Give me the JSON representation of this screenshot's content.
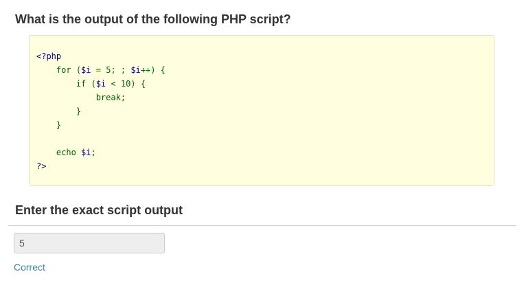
{
  "question": {
    "title": "What is the output of the following PHP script?"
  },
  "code": {
    "lines": [
      [
        {
          "t": "<?php",
          "c": "tag"
        }
      ],
      [
        {
          "t": "    ",
          "c": ""
        },
        {
          "t": "for",
          "c": "kw"
        },
        {
          "t": " (",
          "c": "punc"
        },
        {
          "t": "$i",
          "c": "var"
        },
        {
          "t": " = ",
          "c": "punc"
        },
        {
          "t": "5",
          "c": "num"
        },
        {
          "t": "; ; ",
          "c": "punc"
        },
        {
          "t": "$i",
          "c": "var"
        },
        {
          "t": "++) {",
          "c": "punc"
        }
      ],
      [
        {
          "t": "        ",
          "c": ""
        },
        {
          "t": "if",
          "c": "kw"
        },
        {
          "t": " (",
          "c": "punc"
        },
        {
          "t": "$i",
          "c": "var"
        },
        {
          "t": " < ",
          "c": "punc"
        },
        {
          "t": "10",
          "c": "num"
        },
        {
          "t": ") {",
          "c": "punc"
        }
      ],
      [
        {
          "t": "            ",
          "c": ""
        },
        {
          "t": "break",
          "c": "kw"
        },
        {
          "t": ";",
          "c": "punc"
        }
      ],
      [
        {
          "t": "        ",
          "c": ""
        },
        {
          "t": "}",
          "c": "punc"
        }
      ],
      [
        {
          "t": "    ",
          "c": ""
        },
        {
          "t": "}",
          "c": "punc"
        }
      ],
      [
        {
          "t": "",
          "c": ""
        }
      ],
      [
        {
          "t": "    ",
          "c": ""
        },
        {
          "t": "echo",
          "c": "kw"
        },
        {
          "t": " ",
          "c": ""
        },
        {
          "t": "$i",
          "c": "var"
        },
        {
          "t": ";",
          "c": "punc"
        }
      ],
      [
        {
          "t": "?>",
          "c": "tag"
        }
      ]
    ]
  },
  "answer": {
    "section_title": "Enter the exact script output",
    "value": "5",
    "result_label": "Correct"
  }
}
